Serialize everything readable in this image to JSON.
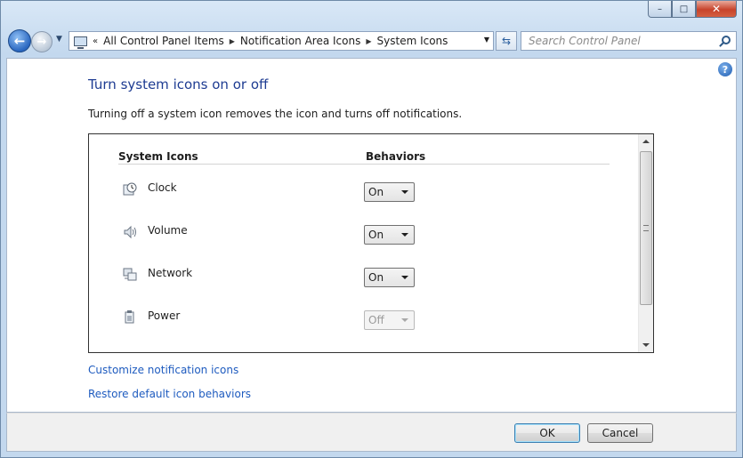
{
  "window": {
    "caption": {
      "minimize": "–",
      "maximize": "□",
      "close": "✕"
    }
  },
  "navbar": {
    "address": {
      "overflow": "«",
      "crumbs": [
        "All Control Panel Items",
        "Notification Area Icons",
        "System Icons"
      ]
    },
    "search": {
      "placeholder": "Search Control Panel"
    }
  },
  "content": {
    "title": "Turn system icons on or off",
    "description": "Turning off a system icon removes the icon and turns off notifications.",
    "table": {
      "headers": {
        "icons": "System Icons",
        "behaviors": "Behaviors"
      },
      "rows": [
        {
          "label": "Clock",
          "icon": "clock-icon",
          "value": "On",
          "enabled": true
        },
        {
          "label": "Volume",
          "icon": "volume-icon",
          "value": "On",
          "enabled": true
        },
        {
          "label": "Network",
          "icon": "network-icon",
          "value": "On",
          "enabled": true
        },
        {
          "label": "Power",
          "icon": "power-icon",
          "value": "Off",
          "enabled": false
        }
      ]
    },
    "links": {
      "customize": "Customize notification icons",
      "restore": "Restore default icon behaviors"
    }
  },
  "footer": {
    "ok": "OK",
    "cancel": "Cancel"
  },
  "colors": {
    "title": "#1e3c92",
    "link": "#1e5bbf",
    "accent": "#2a67c0"
  }
}
